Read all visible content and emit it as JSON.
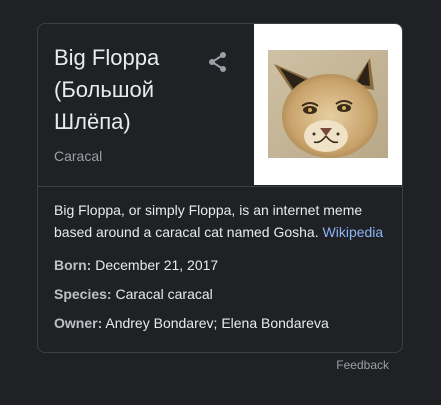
{
  "entity": {
    "title": "Big Floppa (Большой Шлёпа)",
    "subtitle": "Caracal",
    "share_icon": "share-icon"
  },
  "description": {
    "text": "Big Floppa, or simply Floppa, is an internet meme based around a caracal cat named Gosha.",
    "source_link": "Wikipedia"
  },
  "facts": [
    {
      "label": "Born:",
      "value": "December 21, 2017"
    },
    {
      "label": "Species:",
      "value": "Caracal caracal"
    },
    {
      "label": "Owner:",
      "value": "Andrey Bondarev; Elena Bondareva"
    }
  ],
  "footer": {
    "feedback": "Feedback"
  },
  "colors": {
    "background": "#202124",
    "border": "#3c4043",
    "link": "#8ab4f8",
    "secondary_text": "#9aa0a6"
  }
}
